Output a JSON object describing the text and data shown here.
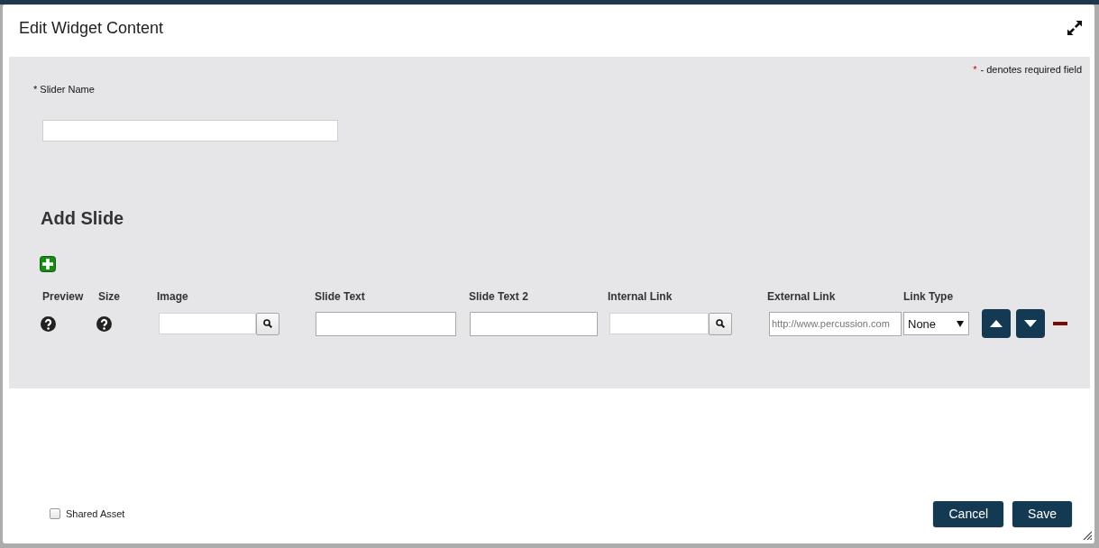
{
  "dialog": {
    "title": "Edit Widget Content"
  },
  "form": {
    "required_note": {
      "mark": "*",
      "text": "- denotes required field"
    },
    "slider_name": {
      "label": "* Slider Name"
    },
    "section_title": "Add Slide",
    "columns": [
      "Preview",
      "Size",
      "Image",
      "Slide Text",
      "Slide Text 2",
      "Internal Link",
      "External Link",
      "Link Type"
    ],
    "slides": [
      {
        "cells": [
          {
            "kind": "help"
          },
          {
            "kind": "help"
          },
          {
            "kind": "browse"
          },
          {
            "kind": "text"
          },
          {
            "kind": "text"
          },
          {
            "kind": "browse"
          },
          {
            "kind": "text",
            "placeholder": "http://www.percussion.com"
          },
          {
            "kind": "select",
            "value": "None"
          }
        ]
      }
    ]
  },
  "footer": {
    "shared_asset": {
      "label": "Shared Asset",
      "checked": false
    },
    "buttons": [
      {
        "label": "Cancel"
      },
      {
        "label": "Save"
      }
    ]
  }
}
